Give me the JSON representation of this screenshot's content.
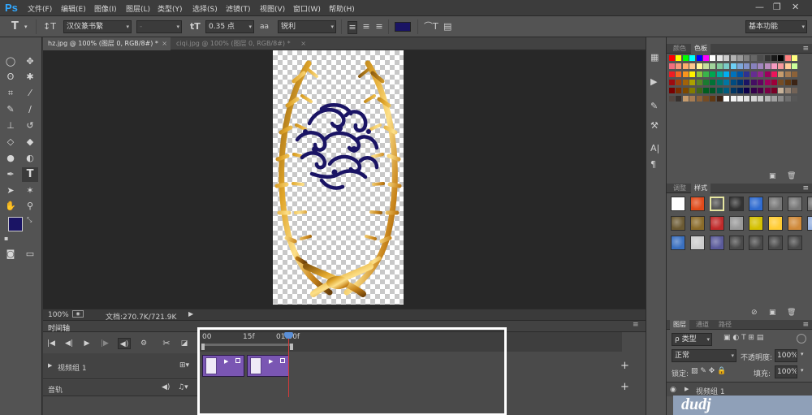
{
  "app": {
    "logo": "Ps"
  },
  "menu": [
    "文件(F)",
    "编辑(E)",
    "图像(I)",
    "图层(L)",
    "类型(Y)",
    "选择(S)",
    "滤镜(T)",
    "视图(V)",
    "窗口(W)",
    "帮助(H)"
  ],
  "options": {
    "font_family": "汉仪篆书繁",
    "font_style": "-",
    "font_size": "0.35 点",
    "aa_label": "aa",
    "antialias": "锐利",
    "text_color": "#1a1464",
    "workspace": "基本功能"
  },
  "tabs": [
    {
      "label": "hz.jpg @ 100% (图层 0, RGB/8#) *",
      "active": true
    },
    {
      "label": "ciqi.jpg @ 100% (图层 0, RGB/8#) *",
      "active": false
    }
  ],
  "status": {
    "zoom": "100%",
    "doc": "文档:270.7K/721.9K"
  },
  "timeline": {
    "title": "时间轴",
    "ruler": [
      "00",
      "15f",
      "01:00f"
    ],
    "tracks": [
      {
        "name": "视频组 1"
      },
      {
        "name": "音轨"
      }
    ]
  },
  "panels": {
    "color_tabs": [
      "颜色",
      "色板"
    ],
    "style_tabs": [
      "调整",
      "样式"
    ],
    "layer_tabs": [
      "图层",
      "通道",
      "路径"
    ],
    "filter_kind": "ρ 类型",
    "blend_mode": "正常",
    "opacity_label": "不透明度:",
    "opacity": "100%",
    "lock_label": "锁定:",
    "fill_label": "填充:",
    "fill": "100%",
    "layer_name": "视频组 1"
  },
  "colors": {
    "foreground": "#1a1464",
    "background": "#ffffff"
  },
  "watermark": "dudj"
}
